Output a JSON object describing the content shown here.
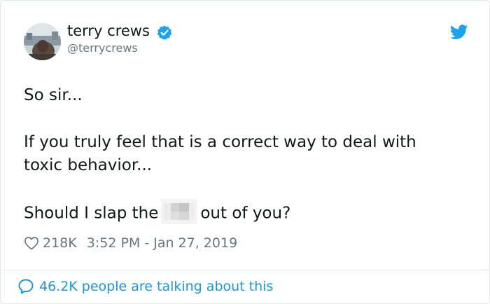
{
  "author": {
    "display_name": "terry crews",
    "handle": "@terrycrews",
    "verified": true
  },
  "tweet": {
    "line1": "So sir...",
    "line2": "If you truly feel that is a correct way to deal with",
    "line3": "toxic behavior...",
    "line4_before": "Should I slap the",
    "line4_after": "out of you?"
  },
  "meta": {
    "likes": "218K",
    "timestamp": "3:52 PM - Jan 27, 2019"
  },
  "footer": {
    "talking_text": "46.2K people are talking about this"
  },
  "colors": {
    "twitter_blue": "#1da1f2",
    "link_blue": "#1b95e0",
    "meta_gray": "#657786",
    "text": "#14171a"
  },
  "icons": {
    "verified": "verified-badge-icon",
    "logo": "twitter-bird-icon",
    "like": "heart-icon",
    "reply": "speech-bubble-icon"
  }
}
